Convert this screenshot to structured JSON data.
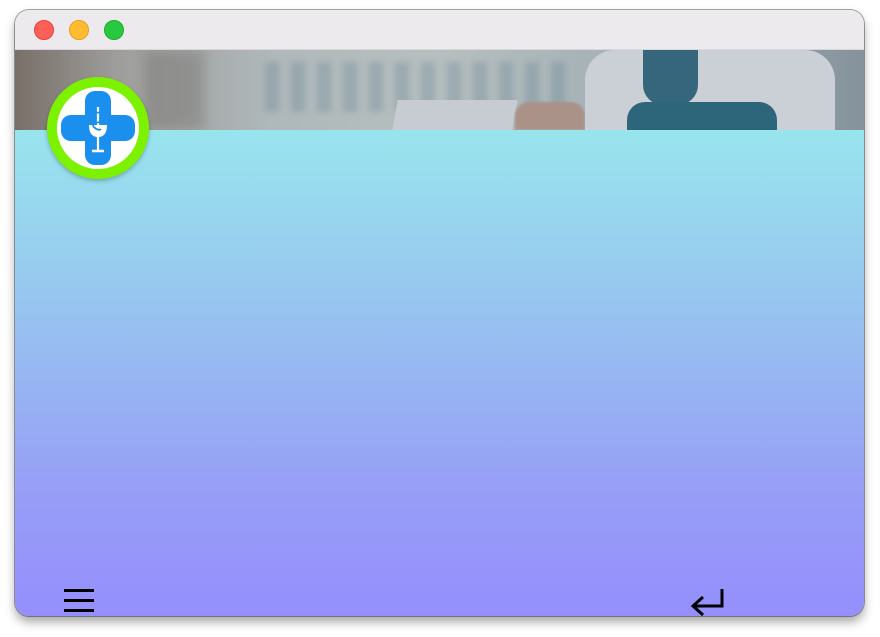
{
  "window": {
    "controls": [
      "close",
      "minimize",
      "zoom"
    ]
  },
  "hero": {
    "image": "pharmacist-background-photo"
  },
  "logo": {
    "icon": "pharmacy-cross-icon",
    "ring_color": "#7cf200",
    "cross_color": "#1a8fee"
  },
  "colors": {
    "gradient_top": "#98e5ed",
    "gradient_bottom": "#958ffd"
  },
  "footer": {
    "menu_icon": "hamburger-menu-icon",
    "return_icon": "return-arrow-icon"
  }
}
